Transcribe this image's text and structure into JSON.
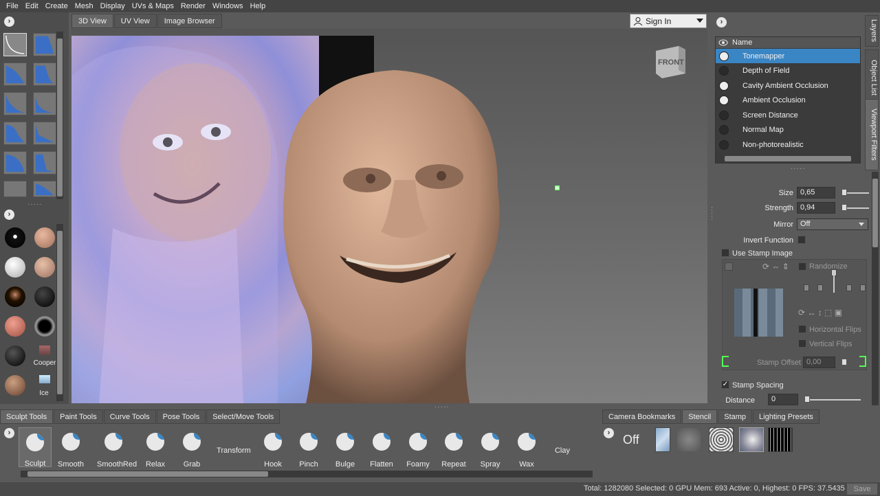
{
  "menu": [
    "File",
    "Edit",
    "Create",
    "Mesh",
    "Display",
    "UVs & Maps",
    "Render",
    "Windows",
    "Help"
  ],
  "viewport_tabs": [
    "3D View",
    "UV View",
    "Image Browser"
  ],
  "sign_in": {
    "label": "Sign In"
  },
  "view_cube": {
    "face": "FRONT"
  },
  "side_tabs": [
    "Layers",
    "Object List",
    "Viewport Filters"
  ],
  "filters": {
    "header": "Name",
    "items": [
      {
        "label": "Tonemapper",
        "on": true
      },
      {
        "label": "Depth of Field",
        "on": false
      },
      {
        "label": "Cavity Ambient Occlusion",
        "on": true
      },
      {
        "label": "Ambient Occlusion",
        "on": true
      },
      {
        "label": "Screen Distance",
        "on": false
      },
      {
        "label": "Normal Map",
        "on": false
      },
      {
        "label": "Non-photorealistic",
        "on": false
      }
    ]
  },
  "props": {
    "size_label": "Size",
    "size_value": "0,65",
    "strength_label": "Strength",
    "strength_value": "0,94",
    "mirror_label": "Mirror",
    "mirror_value": "Off",
    "invert_label": "Invert Function",
    "use_stamp_label": "Use Stamp Image",
    "randomize_label": "Randomize",
    "hflips_label": "Horizontal Flips",
    "vflips_label": "Vertical Flips",
    "stamp_offset_label": "Stamp Offset",
    "stamp_offset_value": "0,00",
    "stamp_spacing_label": "Stamp Spacing",
    "distance_label": "Distance",
    "distance_value": "0"
  },
  "materials": {
    "cooper_label": "Cooper",
    "ice_label": "Ice"
  },
  "bottom_tabs": [
    "Sculpt Tools",
    "Paint Tools",
    "Curve Tools",
    "Pose Tools",
    "Select/Move Tools"
  ],
  "tools": [
    "Sculpt",
    "Smooth",
    "SmoothRed",
    "Relax",
    "Grab",
    "Transform",
    "Hook",
    "Pinch",
    "Bulge",
    "Flatten",
    "Foamy",
    "Repeat",
    "Spray",
    "Wax",
    "Clay"
  ],
  "right_tabs": [
    "Camera Bookmarks",
    "Stencil",
    "Stamp",
    "Lighting Presets"
  ],
  "stencil": {
    "off_label": "Off"
  },
  "status": {
    "text": "Total: 1282080  Selected: 0 GPU Mem: 693  Active: 0, Highest: 0  FPS: 37.5435",
    "save_label": "Save"
  },
  "colors": {
    "accent": "#3a86c5",
    "panel": "#5a5a5a",
    "menubar": "#444444"
  }
}
